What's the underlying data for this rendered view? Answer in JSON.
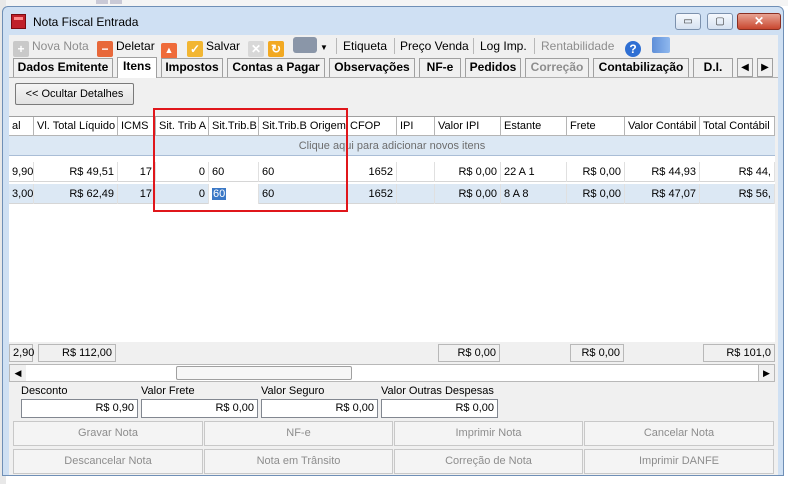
{
  "window": {
    "title": "Nota Fiscal Entrada",
    "minimize_symbol": "▭",
    "restore_symbol": "▢",
    "close_symbol": "✕"
  },
  "toolbar": {
    "nova_nota": "Nova Nota",
    "deletar": "Deletar",
    "salvar": "Salvar",
    "etiqueta": "Etiqueta",
    "preco_venda": "Preço Venda",
    "log_imp": "Log Imp.",
    "rentabilidade": "Rentabilidade",
    "help_symbol": "?"
  },
  "tabs": {
    "items": [
      "Dados Emitente",
      "Itens",
      "Impostos",
      "Contas a Pagar",
      "Observações",
      "NF-e",
      "Pedidos",
      "Correção",
      "Contabilização",
      "D.I."
    ],
    "active": "Itens",
    "arrow_left": "◀",
    "arrow_right": "▶"
  },
  "details": {
    "hide_button": "<< Ocultar Detalhes"
  },
  "grid": {
    "columns": [
      "al",
      "Vl. Total Líquido",
      "ICMS",
      "Sit. Trib A",
      "Sit.Trib.B",
      "Sit.Trib.B Origem",
      "CFOP",
      "IPI",
      "Valor IPI",
      "Estante",
      "Frete",
      "Valor Contábil",
      "Total Contábil"
    ],
    "add_row_text": "Clique aqui para adicionar novos itens",
    "rows": [
      [
        "9,90",
        "R$ 49,51",
        "17",
        "0",
        "60",
        "60",
        "1652",
        "",
        "R$ 0,00",
        "22 A 1",
        "R$ 0,00",
        "R$ 44,93",
        "R$ 44,"
      ],
      [
        "3,00",
        "R$ 62,49",
        "17",
        "0",
        "60",
        "60",
        "1652",
        "",
        "R$ 0,00",
        "8 A 8",
        "R$ 0,00",
        "R$ 47,07",
        "R$ 56,"
      ]
    ],
    "selected_row": 1
  },
  "totals": {
    "col0": "2,90",
    "vl_total_liquido": "R$ 112,00",
    "valor_ipi": "R$ 0,00",
    "frete": "R$ 0,00",
    "total_contabil": "R$ 101,0"
  },
  "scrollbar": {
    "left_arrow": "◀",
    "right_arrow": "▶"
  },
  "fields": {
    "desconto": {
      "label": "Desconto",
      "value": "R$ 0,90"
    },
    "valor_frete": {
      "label": "Valor Frete",
      "value": "R$ 0,00"
    },
    "valor_seguro": {
      "label": "Valor Seguro",
      "value": "R$ 0,00"
    },
    "valor_outras": {
      "label": "Valor Outras Despesas",
      "value": "R$ 0,00"
    }
  },
  "actions": {
    "gravar_nota": "Gravar Nota",
    "nfe": "NF-e",
    "imprimir_nota": "Imprimir Nota",
    "cancelar_nota": "Cancelar Nota",
    "descancelar_nota": "Descancelar Nota",
    "nota_em_transito": "Nota em Trânsito",
    "correcao_de_nota": "Correção de Nota",
    "imprimir_danfe": "Imprimir DANFE"
  },
  "colors": {
    "title_bar": "#cfe0f3",
    "selected_row": "#dce8f4",
    "highlight_box": "#e0161b",
    "edit_selection": "#3b78c6"
  },
  "icons": {
    "nova_nota": "plus-icon",
    "deletar": "minus-icon",
    "up": "arrow-up-icon",
    "salvar": "check-icon",
    "cancel": "x-icon",
    "refresh": "refresh-icon",
    "print": "printer-icon",
    "help": "help-icon",
    "exit": "door-icon"
  }
}
